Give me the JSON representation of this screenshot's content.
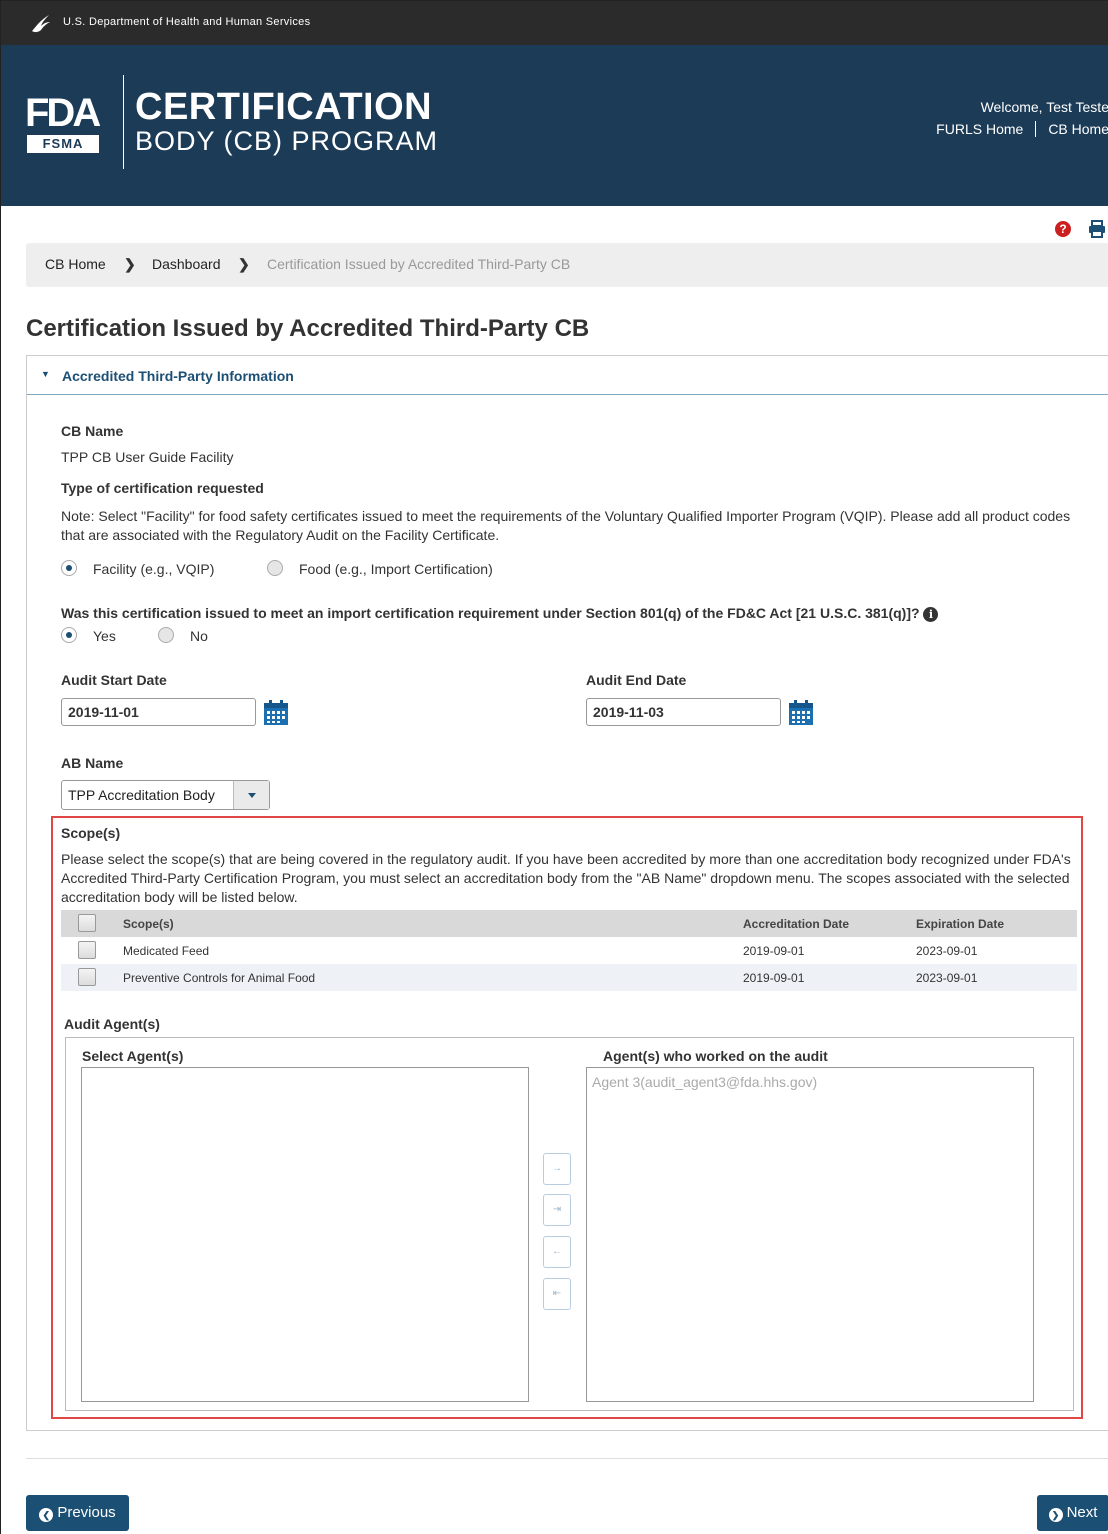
{
  "agency": {
    "name": "U.S. Department of Health and Human Services"
  },
  "header": {
    "logo_fda": "FDA",
    "logo_fsma": "FSMA",
    "program_title_line1": "CERTIFICATION",
    "program_title_line2": "BODY (CB) PROGRAM",
    "welcome": "Welcome, Test Teste",
    "links": [
      "FURLS Home",
      "CB Home"
    ]
  },
  "utility": {
    "help_icon": "question-circle-icon",
    "print_icon": "printer-icon"
  },
  "breadcrumb": {
    "items": [
      "CB Home",
      "Dashboard"
    ],
    "current": "Certification Issued by Accredited Third-Party CB"
  },
  "page": {
    "title": "Certification Issued by Accredited Third-Party CB"
  },
  "panel": {
    "heading": "Accredited Third-Party Information",
    "cb_name_label": "CB Name",
    "cb_name_value": "TPP CB User Guide Facility",
    "cert_type_label": "Type of certification requested",
    "cert_type_note": "Note: Select \"Facility\" for food safety certificates issued to meet the requirements of the Voluntary Qualified Importer Program (VQIP). Please add all product codes that are associated with the Regulatory Audit on the Facility Certificate.",
    "cert_type_options": [
      {
        "label": "Facility (e.g., VQIP)",
        "selected": true
      },
      {
        "label": "Food (e.g., Import Certification)",
        "selected": false
      }
    ],
    "import_question": "Was this certification issued to meet an import certification requirement under Section 801(q) of the FD&C Act [21 U.S.C. 381(q)]?",
    "import_options": [
      {
        "label": "Yes",
        "selected": true
      },
      {
        "label": "No",
        "selected": false
      }
    ],
    "audit_start_label": "Audit Start Date",
    "audit_start_value": "2019-11-01",
    "audit_end_label": "Audit End Date",
    "audit_end_value": "2019-11-03",
    "ab_name_label": "AB Name",
    "ab_name_selected": "TPP Accreditation Body"
  },
  "scopes": {
    "label": "Scope(s)",
    "description": "Please select the scope(s) that are being covered in the regulatory audit. If you have been accredited by more than one accreditation body recognized under FDA's Accredited Third-Party Certification Program, you must select an accreditation body from the \"AB Name\" dropdown menu. The scopes associated with the selected accreditation body will be listed below.",
    "columns": [
      "Scope(s)",
      "Accreditation Date",
      "Expiration Date"
    ],
    "rows": [
      {
        "scope": "Medicated Feed",
        "accreditation_date": "2019-09-01",
        "expiration_date": "2023-09-01"
      },
      {
        "scope": "Preventive Controls for Animal Food",
        "accreditation_date": "2019-09-01",
        "expiration_date": "2023-09-01"
      }
    ]
  },
  "agents": {
    "label": "Audit Agent(s)",
    "select_label": "Select Agent(s)",
    "selected_label": "Agent(s) who worked on the audit",
    "available": [],
    "selected": [
      "Agent 3(audit_agent3@fda.hhs.gov)"
    ],
    "move_buttons": [
      "→",
      "⇥",
      "←",
      "⇤"
    ]
  },
  "footer": {
    "previous_label": "Previous",
    "next_label": "Next"
  },
  "colors": {
    "banner": "#1c3b57",
    "accent": "#1c4f74",
    "highlight": "#e04848",
    "help": "#cc1f1f"
  }
}
